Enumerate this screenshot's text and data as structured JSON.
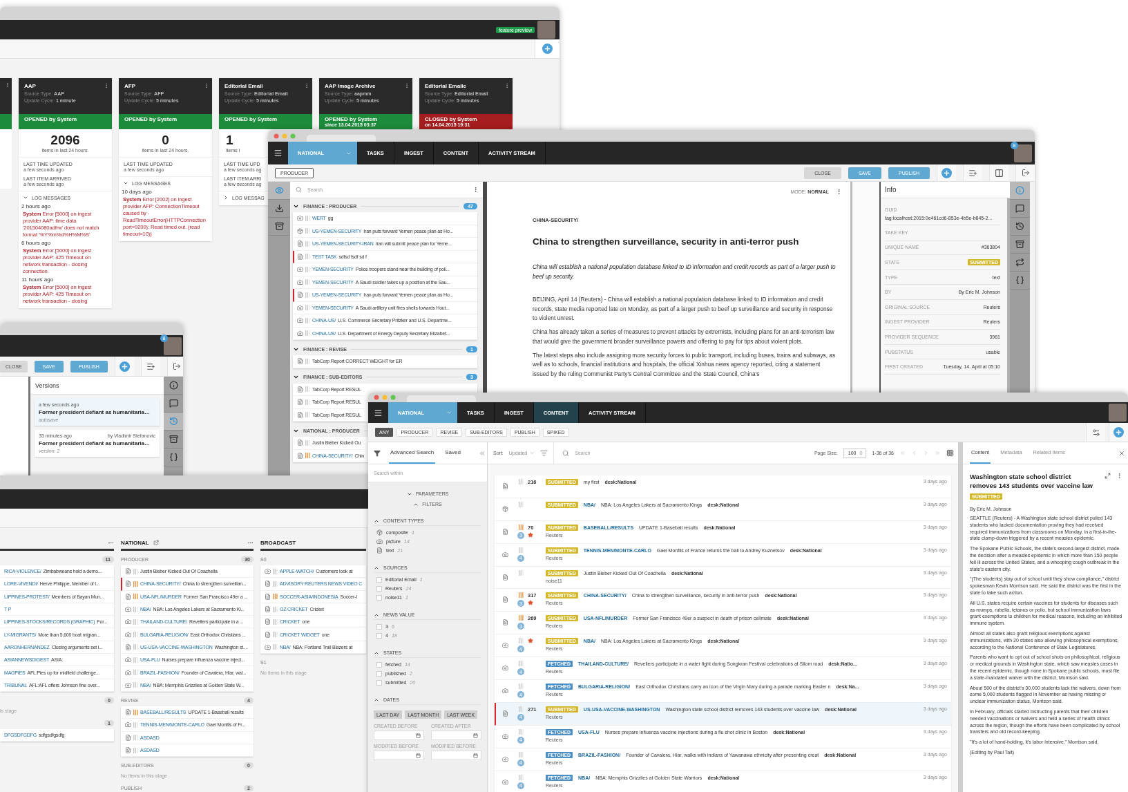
{
  "dashboard": {
    "badge": "feature preview",
    "cards": [
      {
        "name": "AAP",
        "meta": [
          {
            "label": "Source Type:",
            "value": "AAP"
          },
          {
            "label": "Update Cycle:",
            "value": "1 minute"
          }
        ],
        "status": {
          "kind": "opened",
          "text": "OPENED by System"
        },
        "count": "2096",
        "count_label": "items in last 24 hours.",
        "fields": [
          {
            "label": "LAST TIME UPDATED",
            "value": "a few seconds ago"
          },
          {
            "label": "LAST ITEM ARRIVED",
            "value": "a few seconds ago"
          }
        ],
        "log": {
          "title": "LOG MESSAGES",
          "expanded": true,
          "entries": [
            {
              "time": "2 hours ago",
              "text": "**System** Error [5000] on ingest provider AAP: time data '201504080adfrw' does not match format '%Y%m%d%H%M%S'"
            },
            {
              "time": "6 hours ago",
              "text": "**System** Error [5000] on ingest provider AAP: 425 Timeout on network transaction - closing connection."
            },
            {
              "time": "11 hours ago",
              "text": "**System** Error [5000] on ingest provider AAP: 425 Timeout on network transaction - closing"
            }
          ]
        }
      },
      {
        "name": "AFP",
        "meta": [
          {
            "label": "Source Type:",
            "value": "AFP"
          },
          {
            "label": "Update Cycle:",
            "value": "5 minutes"
          }
        ],
        "status": {
          "kind": "opened",
          "text": "OPENED by System"
        },
        "count": "0",
        "count_label": "items in last 24 hours.",
        "fields": [
          {
            "label": "LAST TIME UPDATED",
            "value": "a few seconds ago"
          }
        ],
        "log": {
          "title": "LOG MESSAGES",
          "expanded": true,
          "entries": [
            {
              "time": "10 days ago",
              "text": "**System** Error [2002] on ingest provider AFP: ConnectionTimeout caused by - ReadTimeoutError(HTTPConnection port=9200): Read timed out. (read timeout=10))"
            }
          ]
        }
      },
      {
        "name": "Editorial Email",
        "meta": [
          {
            "label": "Source Type:",
            "value": "Editorial Email"
          },
          {
            "label": "Update Cycle:",
            "value": "5 minutes"
          }
        ],
        "status": {
          "kind": "opened",
          "text": "OPENED by System"
        },
        "count": "1",
        "count_label": "items i",
        "fields": [
          {
            "label": "LAST TIME UPD",
            "value": "a few seconds ag"
          },
          {
            "label": "LAST ITEM ARRI",
            "value": "a few seconds ag"
          }
        ],
        "log": {
          "title": "LOG MESSAG",
          "expanded": false
        }
      },
      {
        "name": "AAP Image Archive",
        "meta": [
          {
            "label": "Source Type:",
            "value": "aapmm"
          },
          {
            "label": "Update Cycle:",
            "value": "5 minutes"
          }
        ],
        "status": {
          "kind": "opened",
          "text": "OPENED by System",
          "since": "since 13.04.2015 03:37"
        }
      },
      {
        "name": "Editorial Emaile",
        "meta": [
          {
            "label": "Source Type:",
            "value": "Editorial Email"
          },
          {
            "label": "Update Cycle:",
            "value": "5 minutes"
          }
        ],
        "status": {
          "kind": "closed",
          "text": "CLOSED by System",
          "since": "on 14.04.2015 19:31"
        }
      }
    ]
  },
  "editor_window": {
    "nav": {
      "desk": "NATIONAL",
      "tabs": [
        {
          "label": "TASKS",
          "selected": false
        },
        {
          "label": "INGEST",
          "selected": false
        },
        {
          "label": "CONTENT",
          "selected": false
        },
        {
          "label": "ACTIVITY STREAM",
          "selected": false
        }
      ]
    },
    "avatar_badge": "8",
    "stage_button": "PRODUCER",
    "buttons": [
      {
        "label": "CLOSE",
        "kind": "plain"
      },
      {
        "label": "SAVE",
        "kind": "primary"
      },
      {
        "label": "PUBLISH",
        "kind": "primary"
      }
    ],
    "left_rail": [
      {
        "kind": "eye",
        "selected": true
      },
      {
        "kind": "download",
        "selected": false
      },
      {
        "kind": "archive",
        "selected": false
      }
    ],
    "search": {
      "placeholder": "Search"
    },
    "groups": [
      {
        "title": "FINANCE : PRODUCER",
        "count": "47",
        "expanded": true,
        "items": [
          {
            "kind": "photo",
            "urgent": false,
            "highlight": false,
            "slug": "WERT",
            "text": "gg"
          },
          {
            "kind": "composite",
            "urgent": false,
            "highlight": false,
            "slug": "US-YEMEN-SECURITY",
            "text": "Iran puts forward Yemen peace plan as Ho..."
          },
          {
            "kind": "text",
            "urgent": false,
            "highlight": false,
            "slug": "US-YEMEN-SECURITY-IRAN",
            "text": "Iran will submit peace plan for Yeme..."
          },
          {
            "kind": "text",
            "urgent": false,
            "highlight": true,
            "slug": "TEST TASK",
            "text": "sdfsd fsdf sd f"
          },
          {
            "kind": "photo",
            "urgent": false,
            "highlight": false,
            "slug": "YEMEN-SECURITY",
            "text": "Police troopers stand near the building of poli..."
          },
          {
            "kind": "photo",
            "urgent": false,
            "highlight": false,
            "slug": "YEMEN-SECURITY",
            "text": "A Saudi soldier takes up a position at the Sau..."
          },
          {
            "kind": "text",
            "urgent": false,
            "highlight": true,
            "slug": "US-YEMEN-SECURITY",
            "text": "Iran puts forward Yemen peace plan as Ho..."
          },
          {
            "kind": "photo",
            "urgent": false,
            "highlight": false,
            "slug": "YEMEN-SECURITY",
            "text": "A Saudi artillery unit fires shells towards Hout..."
          },
          {
            "kind": "photo",
            "urgent": false,
            "highlight": false,
            "slug": "CHINA-US/",
            "text": "U.S. Commerce Secretary Pritzker and U.S. Departme..."
          },
          {
            "kind": "photo",
            "urgent": false,
            "highlight": false,
            "slug": "CHINA-US/",
            "text": "U.S. Department of Energy Deputy Secretary Elizabet..."
          }
        ]
      },
      {
        "title": "FINANCE : REVISE",
        "count": "1",
        "expanded": true,
        "items": [
          {
            "kind": "text",
            "urgent": false,
            "highlight": false,
            "text": "TabCorp Report CORRECT WEIGHT for ER"
          }
        ]
      },
      {
        "title": "FINANCE : SUB-EDITORS",
        "count": "3",
        "expanded": true,
        "items": [
          {
            "kind": "text",
            "urgent": false,
            "highlight": false,
            "text": "TabCorp Report RESUL"
          },
          {
            "kind": "text",
            "urgent": false,
            "highlight": false,
            "text": "TabCorp Report RESUL"
          },
          {
            "kind": "text",
            "urgent": false,
            "highlight": false,
            "text": "TabCorp Report RESUL"
          }
        ]
      },
      {
        "title": "NATIONAL : PRODUCER",
        "expanded": true,
        "items": [
          {
            "kind": "text",
            "urgent": false,
            "highlight": false,
            "text": "Justin Bieber Kicked Ou"
          },
          {
            "kind": "text",
            "urgent": true,
            "highlight": false,
            "slug": "CHINA-SECURITY/",
            "text": "Chin"
          }
        ]
      }
    ],
    "article": {
      "mode_label": "MODE:",
      "mode_value": "NORMAL",
      "slug": "CHINA-SECURITY/",
      "headline": "China to strengthen surveillance, security in anti-terror push",
      "abstract": "China will establish a national population database linked to ID information and credit records as part of a larger push to beef up security.",
      "paragraphs": [
        "BEIJING, April 14 (Reuters) - China will establish a national population database linked to ID information and credit records, state media reported late on Monday, as part of a larger push to beef up surveillance and security in response to violent unrest.",
        "China has already taken a series of measures to prevent attacks by extremists, including plans for an anti-terrorism law that would give the government broader surveillance powers and offering to pay for tips about violent plots.",
        "The latest steps also include assigning more security forces to public transport, including buses, trains and subways, as well as to schools, financial institutions and hospitals, the official Xinhua news agency reported, citing a statement issued by the ruling Communist Party's Central Committee and the State Council, China's"
      ]
    },
    "info": {
      "title": "Info",
      "fields": [
        {
          "kind": "stacked",
          "label": "GUID",
          "value": "tag:localhost:2015:0e461cd6-853e-4b5e-b845-2..."
        },
        {
          "kind": "row",
          "label": "TAKE KEY"
        },
        {
          "kind": "row",
          "label": "UNIQUE NAME",
          "value": "#363804"
        },
        {
          "kind": "badge",
          "label": "STATE",
          "value": "SUBMITTED"
        },
        {
          "kind": "row",
          "label": "TYPE",
          "value": "text"
        },
        {
          "kind": "row",
          "label": "BY",
          "value": "By Eric M. Johnson"
        },
        {
          "kind": "row",
          "label": "ORIGINAL SOURCE",
          "value": "Reuters"
        },
        {
          "kind": "row",
          "label": "INGEST PROVIDER",
          "value": "Reuters"
        },
        {
          "kind": "row",
          "label": "PROVIDER SEQUENCE",
          "value": "3961"
        },
        {
          "kind": "row",
          "label": "PUBSTATUS",
          "value": "usable"
        },
        {
          "kind": "row",
          "label": "FIRST CREATED",
          "value": "Tuesday, 14. April at 05:10"
        }
      ]
    },
    "right_rail": [
      {
        "kind": "info",
        "selected": true
      },
      {
        "kind": "comments",
        "selected": false
      },
      {
        "kind": "history",
        "selected": false
      },
      {
        "kind": "archive",
        "selected": false
      },
      {
        "kind": "sync",
        "selected": false
      },
      {
        "kind": "braces",
        "selected": false
      }
    ]
  },
  "versions_window": {
    "avatar_badge": "8",
    "buttons": [
      {
        "label": "CLOSE",
        "kind": "plain"
      },
      {
        "label": "SAVE",
        "kind": "primary"
      },
      {
        "label": "PUBLISH",
        "kind": "primary"
      }
    ],
    "title": "Versions",
    "versions": [
      {
        "time": "a few seconds ago",
        "title": "Former president defiant as humanitaria…",
        "note": "autosave",
        "selected": true
      },
      {
        "time": "35 minutes ago",
        "author": "by Vladimir Stefanovic",
        "title": "Former president defiant as humanitaria…",
        "note": "version: 2",
        "selected": false
      }
    ],
    "rail": [
      {
        "kind": "info",
        "selected": false
      },
      {
        "kind": "comments",
        "selected": false
      },
      {
        "kind": "history",
        "selected": true
      },
      {
        "kind": "archive",
        "selected": false
      },
      {
        "kind": "braces",
        "selected": false
      }
    ]
  },
  "desk_window": {
    "columns": [
      {
        "stages": [
          {
            "count": "11",
            "items": [
              {
                "slug": "RICA-VIOLENCE/",
                "text": "Zimbabweans hold a demo..."
              },
              {
                "slug": "LORE-VIVENDI/",
                "text": "Herve Philippe, Member of t..."
              },
              {
                "slug": "LIPPINES-PROTEST/",
                "text": "Members of Bayan Mun..."
              },
              {
                "slug": "T P"
              },
              {
                "slug": "LIPPINES-STOCKS/RECORDS (GRAPHIC)",
                "text": "For..."
              },
              {
                "slug": "LY-MIGRANTS/",
                "text": "More than 5,600 boat migran..."
              },
              {
                "slug": "AARONHERNANDEZ",
                "text": "Closing arguments set i..."
              },
              {
                "slug": "ASIANNEWSDIGEST",
                "text": "ASIA:"
              },
              {
                "slug": "MAGPIES",
                "text": "AFL:Pies up for midfield challenge..."
              },
              {
                "slug": "TRIBUNAL",
                "text": "AFL:AFL offers Johnson fine over..."
              }
            ]
          },
          {
            "count": "0",
            "empty": "is stage"
          },
          {
            "count": "1",
            "items": [
              {
                "slug": "DFGSDFGDFG",
                "text": "sdfgsdfgsdfg"
              }
            ]
          }
        ]
      },
      {
        "title": "NATIONAL",
        "stages": [
          {
            "name": "PRODUCER",
            "count": "30",
            "items": [
              {
                "kind": "text",
                "urgent": false,
                "highlight": false,
                "text": "Justin Bieber Kicked Out Of Coachella"
              },
              {
                "kind": "text",
                "urgent": true,
                "highlight": true,
                "slug": "CHINA-SECURITY/",
                "text": "China to strengthen surveillan..."
              },
              {
                "kind": "text",
                "urgent": true,
                "highlight": false,
                "slug": "USA-NFL/MURDER",
                "text": "Former San Francisco 49er a ..."
              },
              {
                "kind": "photo",
                "urgent": false,
                "highlight": false,
                "slug": "NBA/",
                "text": "NBA: Los Angeles Lakers at Sacramento Ki..."
              },
              {
                "kind": "photo",
                "urgent": false,
                "highlight": false,
                "slug": "THAILAND-CULTURE/",
                "text": "Revellers participate in a ..."
              },
              {
                "kind": "photo",
                "urgent": false,
                "highlight": false,
                "slug": "BULGARIA-RELIGION/",
                "text": "East Orthodox Christians ..."
              },
              {
                "kind": "text",
                "urgent": false,
                "highlight": false,
                "slug": "US-USA-VACCINE-WASHINGTON",
                "text": "Washington st..."
              },
              {
                "kind": "photo",
                "urgent": false,
                "highlight": false,
                "slug": "USA-FLU",
                "text": "Nurses prepare influenza vaccine inject..."
              },
              {
                "kind": "photo",
                "urgent": false,
                "highlight": false,
                "slug": "BRAZIL-FASHION/",
                "text": "Founder of Cavalera, Hiar, wal..."
              },
              {
                "kind": "photo",
                "urgent": false,
                "highlight": false,
                "slug": "NBA/",
                "text": "NBA: Memphis Grizzlies at Golden State W..."
              }
            ]
          },
          {
            "name": "REVISE",
            "count": "4",
            "items": [
              {
                "kind": "text",
                "urgent": true,
                "highlight": false,
                "slug": "BASEBALL/RESULTS",
                "text": "UPDATE 1-Baseball results"
              },
              {
                "kind": "photo",
                "urgent": false,
                "highlight": false,
                "slug": "TENNIS-MEN/MONTE-CARLO",
                "text": "Gael Monfils of Fr..."
              },
              {
                "kind": "text",
                "urgent": false,
                "highlight": false,
                "slug": "ASDASD"
              },
              {
                "kind": "text",
                "urgent": false,
                "highlight": false,
                "slug": "ASDASD"
              }
            ]
          },
          {
            "name": "SUB-EDITORS",
            "count": "0",
            "empty": "No items in this stage"
          },
          {
            "name": "PUBLISH",
            "count": "2"
          }
        ]
      },
      {
        "title": "BROADCAST",
        "stages": [
          {
            "name": "S0",
            "items": [
              {
                "kind": "photo",
                "urgent": false,
                "highlight": false,
                "slug": "APPLE-WATCH/",
                "text": "Customers look at"
              },
              {
                "kind": "text",
                "urgent": false,
                "highlight": false,
                "slug": "ADVISORY REUTERS NEWS VIDEO C"
              },
              {
                "kind": "text",
                "urgent": true,
                "highlight": false,
                "slug": "SOCCER-ASIA/INDONESIA",
                "text": "Soccer-I"
              },
              {
                "kind": "text",
                "urgent": false,
                "highlight": false,
                "slug": "OZ CRICKET",
                "text": "Cricket"
              },
              {
                "kind": "text",
                "urgent": false,
                "highlight": false,
                "slug": "CRICKET",
                "text": "one"
              },
              {
                "kind": "text",
                "urgent": false,
                "highlight": false,
                "slug": "CRICKET WIDGET",
                "text": "one"
              },
              {
                "kind": "photo",
                "urgent": false,
                "highlight": false,
                "slug": "NBA/",
                "text": "NBA: Portland Trail Blazers at"
              }
            ]
          },
          {
            "name": "S1",
            "empty": "No items in this stage"
          }
        ]
      }
    ]
  },
  "content_window": {
    "nav": {
      "desk": "NATIONAL",
      "tabs": [
        {
          "label": "TASKS",
          "selected": false
        },
        {
          "label": "INGEST",
          "selected": false
        },
        {
          "label": "CONTENT",
          "selected": true
        },
        {
          "label": "ACTIVITY STREAM",
          "selected": false
        }
      ]
    },
    "stage_filters": [
      {
        "label": "ANY",
        "selected": true
      },
      {
        "label": "PRODUCER",
        "selected": false
      },
      {
        "label": "REVISE",
        "selected": false
      },
      {
        "label": "SUB-EDITORS",
        "selected": false
      },
      {
        "label": "PUBLISH",
        "selected": false
      },
      {
        "label": "SPIKED",
        "selected": false
      }
    ],
    "search_tabs": [
      {
        "label": "Advanced Search",
        "selected": true
      },
      {
        "label": "Saved",
        "selected": false
      }
    ],
    "search_within": {
      "placeholder": "Search within"
    },
    "parameters": {
      "label": "PARAMETERS",
      "expanded": false
    },
    "filters": {
      "label": "FILTERS",
      "expanded": true
    },
    "facets": [
      {
        "title": "CONTENT TYPES",
        "kind": "types",
        "options": [
          {
            "kind": "composite",
            "label": "composite",
            "count": "1"
          },
          {
            "kind": "photo",
            "label": "picture",
            "count": "14"
          },
          {
            "kind": "text",
            "label": "text",
            "count": "21"
          }
        ]
      },
      {
        "title": "SOURCES",
        "kind": "checks",
        "options": [
          {
            "label": "Editorial Email",
            "count": "1",
            "checked": false
          },
          {
            "label": "Reuters",
            "count": "24",
            "checked": false
          },
          {
            "label": "noise11",
            "count": "1",
            "checked": false
          }
        ]
      },
      {
        "title": "NEWS VALUE",
        "kind": "checks",
        "options": [
          {
            "label": "3",
            "count": "6",
            "checked": false
          },
          {
            "label": "4",
            "count": "18",
            "checked": false
          }
        ]
      },
      {
        "title": "STATES",
        "kind": "checks",
        "options": [
          {
            "label": "fetched",
            "count": "14",
            "checked": false
          },
          {
            "label": "published",
            "count": "2",
            "checked": false
          },
          {
            "label": "submitted",
            "count": "20",
            "checked": false
          }
        ]
      }
    ],
    "dates": {
      "title": "DATES",
      "presets": [
        "LAST DAY",
        "LAST MONTH",
        "LAST WEEK"
      ],
      "fields": [
        "CREATED BEFORE",
        "CREATED AFTER",
        "MODIFIED BEFORE",
        "MODIFIED BEFORE"
      ]
    },
    "sort": {
      "label": "Sort:",
      "value": "Updated"
    },
    "search": {
      "placeholder": "Search"
    },
    "page_size": {
      "label": "Page Size:",
      "value": "100"
    },
    "range": "1-36 of 36",
    "items": [
      {
        "kind": "text",
        "urgent": false,
        "number": "216",
        "starred": false,
        "state": {
          "kind": "submitted",
          "label": "SUBMITTED"
        },
        "headline": "my first",
        "desk": "desk:National",
        "time": "3 days ago",
        "selected": false
      },
      {
        "kind": "composite",
        "urgent": false,
        "starred": false,
        "state": {
          "kind": "submitted",
          "label": "SUBMITTED"
        },
        "slug": "NBA/",
        "headline": "NBA: Los Angeles Lakers at Sacramento Kings",
        "desk": "desk:National",
        "time": "3 days ago",
        "selected": false
      },
      {
        "kind": "text",
        "urgent": true,
        "priority": "3",
        "number": "70",
        "starred": true,
        "state": {
          "kind": "submitted",
          "label": "SUBMITTED"
        },
        "slug": "BASEBALL/RESULTS",
        "headline": "UPDATE 1-Baseball results",
        "desk": "desk:National",
        "source": "Reuters",
        "time": "3 days ago",
        "selected": false
      },
      {
        "kind": "photo",
        "urgent": false,
        "priority": "4",
        "starred": false,
        "state": {
          "kind": "submitted",
          "label": "SUBMITTED"
        },
        "slug": "TENNIS-MEN/MONTE-CARLO",
        "headline": "Gael Monfils of France returns the ball to Andrey Kuznetsov",
        "desk": "desk:National",
        "source": "Reuters",
        "time": "3 days ago",
        "selected": false
      },
      {
        "kind": "text",
        "urgent": false,
        "starred": false,
        "state": {
          "kind": "submitted",
          "label": "SUBMITTED"
        },
        "headline": "Justin Bieber Kicked Out Of Coachella",
        "desk": "desk:National",
        "source": "noise11",
        "time": "3 days ago",
        "selected": false
      },
      {
        "kind": "text",
        "urgent": true,
        "priority": "3",
        "number": "317",
        "starred": true,
        "state": {
          "kind": "submitted",
          "label": "SUBMITTED"
        },
        "slug": "CHINA-SECURITY/",
        "headline": "China to strengthen surveillance, security in anti-terror push",
        "desk": "desk:National",
        "source": "Reuters",
        "time": "3 days ago",
        "selected": false
      },
      {
        "kind": "text",
        "urgent": true,
        "priority": "3",
        "number": "269",
        "starred": false,
        "state": {
          "kind": "submitted",
          "label": "SUBMITTED"
        },
        "slug": "USA-NFL/MURDER",
        "headline": "Former San Francisco 49er a suspect in death of prison cellmate",
        "desk": "desk:National",
        "source": "Reuters",
        "time": "3 days ago",
        "selected": false
      },
      {
        "kind": "photo",
        "urgent": false,
        "priority": "4",
        "starred": true,
        "state": {
          "kind": "submitted",
          "label": "SUBMITTED"
        },
        "slug": "NBA/",
        "headline": "NBA: Los Angeles Lakers at Sacramento Kings",
        "desk": "desk:National",
        "source": "Reuters",
        "time": "3 days ago",
        "selected": false
      },
      {
        "kind": "photo",
        "urgent": false,
        "priority": "4",
        "starred": false,
        "state": {
          "kind": "fetched",
          "label": "FETCHED"
        },
        "slug": "THAILAND-CULTURE/",
        "headline": "Revellers participate in a water fight during Songkran Festival celebrations at Silom road",
        "desk": "desk:Natio...",
        "source": "Reuters",
        "time": "3 days ago",
        "selected": false
      },
      {
        "kind": "photo",
        "urgent": false,
        "priority": "4",
        "starred": false,
        "state": {
          "kind": "fetched",
          "label": "FETCHED"
        },
        "slug": "BULGARIA-RELIGION/",
        "headline": "East Orthodox Christians carry an icon of the Virgin Mary during a parade marking Easter n",
        "desk": "desk:Na...",
        "source": "Reuters",
        "time": "3 days ago",
        "selected": false
      },
      {
        "kind": "text",
        "urgent": false,
        "priority": "4",
        "number": "271",
        "starred": false,
        "state": {
          "kind": "submitted",
          "label": "SUBMITTED"
        },
        "slug": "US-USA-VACCINE-WASHINGTON",
        "headline": "Washington state school district removes 143 students over vaccine law",
        "desk": "desk:National",
        "source": "Reuters",
        "time": "3 days ago",
        "selected": true
      },
      {
        "kind": "photo",
        "urgent": false,
        "priority": "4",
        "starred": false,
        "state": {
          "kind": "fetched",
          "label": "FETCHED"
        },
        "slug": "USA-FLU",
        "headline": "Nurses prepare influenza vaccine injections during a flu shot clinic in Boston",
        "desk": "desk:National",
        "source": "Reuters",
        "time": "3 days ago",
        "selected": false
      },
      {
        "kind": "photo",
        "urgent": false,
        "priority": "4",
        "starred": false,
        "state": {
          "kind": "fetched",
          "label": "FETCHED"
        },
        "slug": "BRAZIL-FASHION/",
        "headline": "Founder of Cavalera, Hiar, walks with indians of Yawanawa ethnicity after presenting creat",
        "desk": "desk:National",
        "source": "Reuters",
        "time": "3 days ago",
        "selected": false
      },
      {
        "kind": "photo",
        "urgent": false,
        "priority": "4",
        "starred": false,
        "state": {
          "kind": "fetched",
          "label": "FETCHED"
        },
        "slug": "NBA/",
        "headline": "NBA: Memphis Grizzlies at Golden State Warriors",
        "desk": "desk:National",
        "source": "Reuters",
        "time": "3 days ago",
        "selected": false
      }
    ],
    "preview": {
      "tabs": [
        {
          "label": "Content",
          "selected": true
        },
        {
          "label": "Metadata",
          "selected": false
        },
        {
          "label": "Related Items",
          "selected": false
        }
      ],
      "headline": "Washington state school district removes 143 students over vaccine law",
      "state": {
        "kind": "submitted",
        "label": "SUBMITTED"
      },
      "byline": "By Eric M. Johnson",
      "paragraphs": [
        "SEATTLE (Reuters) - A Washington state school district pulled 143 students who lacked documentation proving they had received required immunizations from classrooms on Monday, in a first-in-the-state clamp-down triggered by a recent measles epidemic.",
        "The Spokane Public Schools, the state's second-largest district, made the decision after a measles epidemic in which more than 150 people fell ill across the United States, and a whooping cough outbreak in the state's eastern city.",
        "\"(The students) stay out of school until they show compliance,\" district spokesman Kevin Morrison said. He said the district was the first in the state to take such action.",
        "All U.S. states require certain vaccines for students for diseases such as mumps, rubella, tetanus or polio, but school immunization laws grant exemptions to children for medical reasons, including an inhibited immune system.",
        "Almost all states also grant religious exemptions against immunizations, with 20 states also allowing philosophical exemptions, according to the National Conference of State Legislatures.",
        "Parents who want to opt out of school shots on philosophical, religious or medical grounds in Washington state, which saw measles cases in the recent epidemic, though none in Spokane public schools, must file a state-mandated waiver with the district, Morrison said.",
        "About 500 of the district's 30,000 students lack the waivers, down from some 5,000 students flagged in November as having missing or unclear immunization status, Morrison said.",
        "In February, officials started instructing parents that their children needed vaccinations or waivers and held a series of health clinics across the region, though the efforts have been complicated by school transfers and old record-keeping.",
        "\"It's a lot of hand-holding, it's labor intensive,\" Morrison said.",
        "(Editing by Paul Tait)"
      ]
    }
  }
}
